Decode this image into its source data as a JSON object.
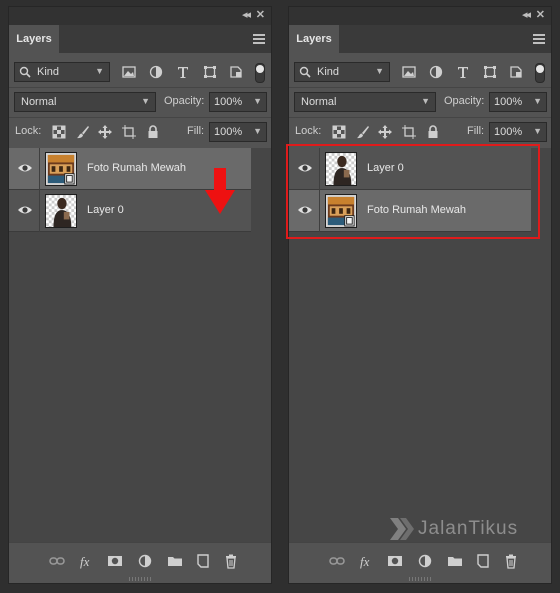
{
  "panels": [
    {
      "id": "left",
      "tab_label": "Layers",
      "kind_label": "Kind",
      "blend_mode": "Normal",
      "opacity_label": "Opacity:",
      "opacity_value": "100%",
      "lock_label": "Lock:",
      "fill_label": "Fill:",
      "fill_value": "100%",
      "layers": [
        {
          "name": "Foto Rumah Mewah",
          "selected": true,
          "thumb": "house"
        },
        {
          "name": "Layer 0",
          "selected": false,
          "thumb": "person"
        }
      ]
    },
    {
      "id": "right",
      "tab_label": "Layers",
      "kind_label": "Kind",
      "blend_mode": "Normal",
      "opacity_label": "Opacity:",
      "opacity_value": "100%",
      "lock_label": "Lock:",
      "fill_label": "Fill:",
      "fill_value": "100%",
      "layers": [
        {
          "name": "Layer 0",
          "selected": false,
          "thumb": "person"
        },
        {
          "name": "Foto Rumah Mewah",
          "selected": true,
          "thumb": "house"
        }
      ]
    }
  ],
  "window_controls": {
    "collapse": "◂◂",
    "close": "✕"
  },
  "watermark": "JalanTikus",
  "colors": {
    "highlight": "#e01b1b",
    "arrow": "#ee1111",
    "panel_bg": "#535353"
  }
}
